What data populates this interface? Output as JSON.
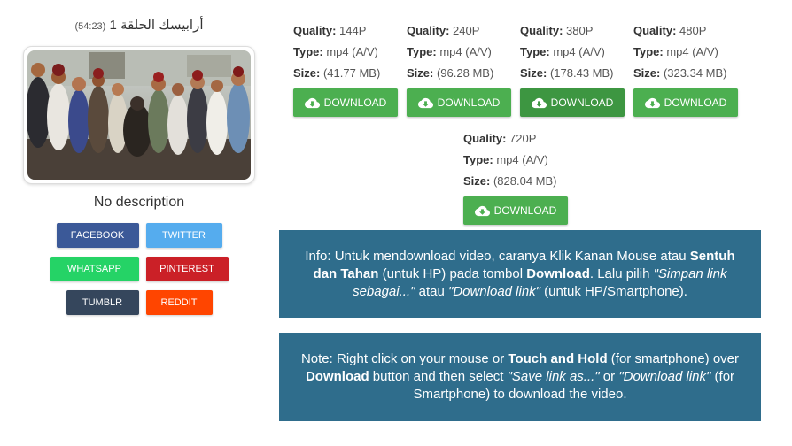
{
  "video": {
    "title": "أرابيسك الحلقة 1",
    "duration": "(54:23)",
    "description": "No description"
  },
  "share": {
    "row1": [
      {
        "label": "FACEBOOK",
        "color": "#3b5998"
      },
      {
        "label": "TWITTER",
        "color": "#55acee"
      }
    ],
    "row2": [
      {
        "label": "WHATSAPP",
        "color": "#25d366"
      },
      {
        "label": "PINTEREST",
        "color": "#cb2027"
      }
    ],
    "row3": [
      {
        "label": "TUMBLR",
        "color": "#35465c"
      },
      {
        "label": "REDDIT",
        "color": "#ff4500"
      }
    ]
  },
  "labels": {
    "quality": "Quality:",
    "type": "Type:",
    "size": "Size:",
    "download": "DOWNLOAD"
  },
  "qualities": [
    {
      "quality": "144P",
      "type": "mp4 (A/V)",
      "size": "(41.77 MB)"
    },
    {
      "quality": "240P",
      "type": "mp4 (A/V)",
      "size": "(96.28 MB)"
    },
    {
      "quality": "380P",
      "type": "mp4 (A/V)",
      "size": "(178.43 MB)"
    },
    {
      "quality": "480P",
      "type": "mp4 (A/V)",
      "size": "(323.34 MB)"
    },
    {
      "quality": "720P",
      "type": "mp4 (A/V)",
      "size": "(828.04 MB)"
    }
  ],
  "info": {
    "label": "Info:",
    "t1": " Untuk mendownload video, caranya Klik Kanan Mouse atau ",
    "b1": "Sentuh dan Tahan",
    "t2": " (untuk HP) pada tombol ",
    "b2": "Download",
    "t3": ". Lalu pilih ",
    "i1": "\"Simpan link sebagai...\"",
    "t4": " atau ",
    "i2": "\"Download link\"",
    "t5": " (untuk HP/Smartphone)."
  },
  "note": {
    "label": "Note:",
    "t1": " Right click on your mouse or ",
    "b1": "Touch and Hold",
    "t2": " (for smartphone) over ",
    "b2": "Download",
    "t3": " button and then select ",
    "i1": "\"Save link as...\"",
    "t4": " or ",
    "i2": "\"Download link\"",
    "t5": " (for Smartphone) to download the video."
  },
  "colors": {
    "download_green": "#4caf50",
    "info_bg": "#2f6d8c"
  }
}
